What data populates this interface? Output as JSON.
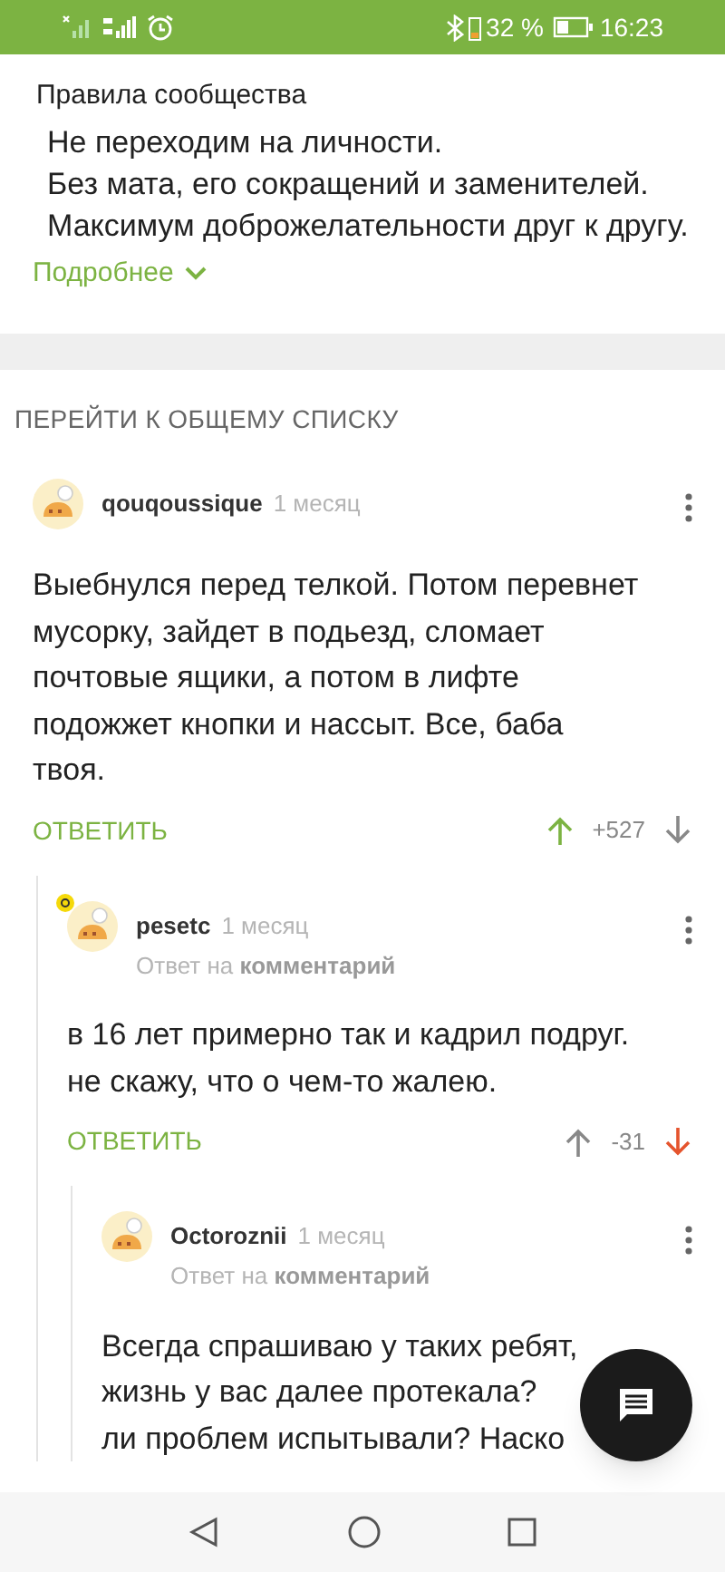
{
  "status_bar": {
    "battery": "32 %",
    "time": "16:23"
  },
  "rules": {
    "title": "Правила сообщества",
    "lines": [
      "Не переходим на личности.",
      "Без мата, его сокращений и заменителей.",
      "Максимум доброжелательности друг к другу."
    ],
    "more": "Подробнее"
  },
  "go_to_list": "ПЕРЕЙТИ К ОБЩЕМУ СПИСКУ",
  "comments": [
    {
      "author": "qouqoussique",
      "time": "1 месяц",
      "badge": false,
      "lines": [
        "Выебнулся перед телкой. Потом перевнет",
        "мусорку, зайдет в подьезд, сломает",
        "почтовые ящики, а потом в лифте",
        "подожжет кнопки и нассыт. Все, баба",
        "твоя."
      ],
      "reply": "ОТВЕТИТЬ",
      "rating": "+527",
      "upvoted": true,
      "downvoted": false,
      "children": [
        {
          "author": "pesetc",
          "time": "1 месяц",
          "badge": true,
          "reply_to": {
            "prefix": "Ответ на",
            "link": "комментарий"
          },
          "lines": [
            "в 16 лет примерно так и кадрил подруг.",
            "не скажу, что о чем-то жалею."
          ],
          "reply": "ОТВЕТИТЬ",
          "rating": "-31",
          "upvoted": false,
          "downvoted": true,
          "children": [
            {
              "author": "Octoroznii",
              "time": "1 месяц",
              "badge": false,
              "reply_to": {
                "prefix": "Ответ на",
                "link": "комментарий"
              },
              "lines": [
                "Всегда спрашиваю у таких ребят,",
                "жизнь у вас далее протекала?",
                "ли проблем испытывали? Наско"
              ]
            }
          ]
        }
      ]
    }
  ]
}
